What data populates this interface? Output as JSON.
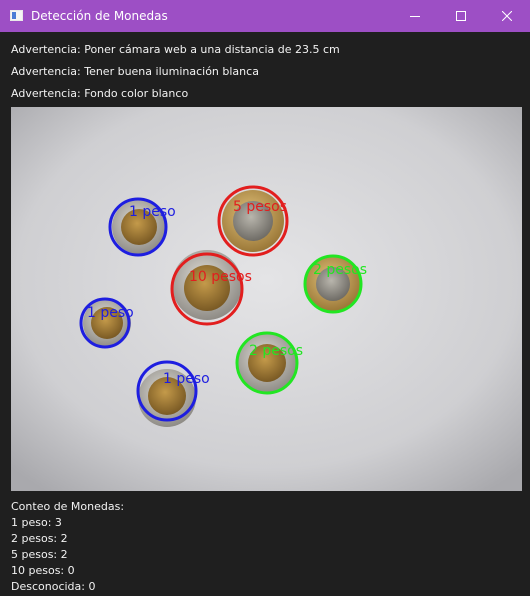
{
  "window": {
    "title": "Detección de Monedas"
  },
  "warnings": [
    "Advertencia: Poner cámara web a una distancia de 23.5 cm",
    "Advertencia: Tener buena iluminación blanca",
    "Advertencia: Fondo color blanco"
  ],
  "camera": {
    "detections": [
      {
        "label": "1 peso",
        "color": "#1e1ee0"
      },
      {
        "label": "5 pesos",
        "color": "#e21e1e"
      },
      {
        "label": "10 pesos",
        "color": "#e21e1e"
      },
      {
        "label": "2 pesos",
        "color": "#22e622"
      },
      {
        "label": "1 peso",
        "color": "#1e1ee0"
      },
      {
        "label": "2 pesos",
        "color": "#22e622"
      },
      {
        "label": "1 peso",
        "color": "#1e1ee0"
      }
    ]
  },
  "counts": {
    "header": "Conteo de Monedas:",
    "lines": [
      "1 peso: 3",
      "2 pesos: 2",
      "5 pesos: 2",
      "10 pesos: 0",
      "Desconocida: 0"
    ]
  },
  "colors": {
    "titlebar": "#9d4fc5",
    "background": "#1f1f1f"
  }
}
